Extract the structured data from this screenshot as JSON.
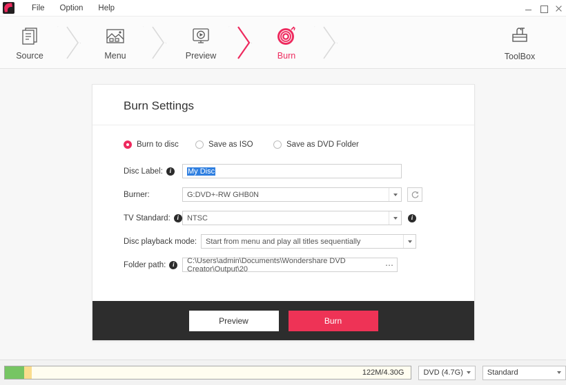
{
  "window": {
    "logo_icon": "app-logo-icon",
    "menus": [
      "File",
      "Option",
      "Help"
    ],
    "controls": {
      "minimize": "minimize",
      "maximize": "maximize",
      "close": "close"
    }
  },
  "toolbar": {
    "steps": [
      {
        "label": "Source",
        "icon": "document-stack-icon",
        "active": false
      },
      {
        "label": "Menu",
        "icon": "picture-frame-icon",
        "active": false
      },
      {
        "label": "Preview",
        "icon": "monitor-play-icon",
        "active": false
      },
      {
        "label": "Burn",
        "icon": "burning-disc-icon",
        "active": true
      }
    ],
    "toolbox": {
      "label": "ToolBox",
      "icon": "toolbox-icon"
    },
    "active_color": "#ee2a5e"
  },
  "panel": {
    "title": "Burn Settings",
    "output_modes": [
      {
        "label": "Burn to disc",
        "selected": true
      },
      {
        "label": "Save as ISO",
        "selected": false
      },
      {
        "label": "Save as DVD Folder",
        "selected": false
      }
    ],
    "fields": {
      "disc_label": {
        "label": "Disc Label:",
        "value": "My Disc",
        "selected": true,
        "info": true
      },
      "burner": {
        "label": "Burner:",
        "value": "G:DVD+-RW GHB0N",
        "info": false,
        "refresh_icon": "refresh-icon"
      },
      "tv_standard": {
        "label": "TV Standard:",
        "value": "NTSC",
        "info": true,
        "trailing_info": true
      },
      "playback_mode": {
        "label": "Disc playback mode:",
        "value": "Start from menu and play all titles sequentially",
        "info": false
      },
      "folder_path": {
        "label": "Folder path:",
        "value": "C:\\Users\\admin\\Documents\\Wondershare DVD Creator\\Output\\20",
        "info": true,
        "browse_label": "⋯"
      }
    },
    "footer": {
      "preview_label": "Preview",
      "burn_label": "Burn",
      "burn_color": "#ee3356"
    }
  },
  "statusbar": {
    "capacity_text": "122M/4.30G",
    "used_color": "#76c563",
    "overhead_color": "#fadd8e",
    "disc_type": "DVD (4.7G)",
    "quality": "Standard"
  }
}
